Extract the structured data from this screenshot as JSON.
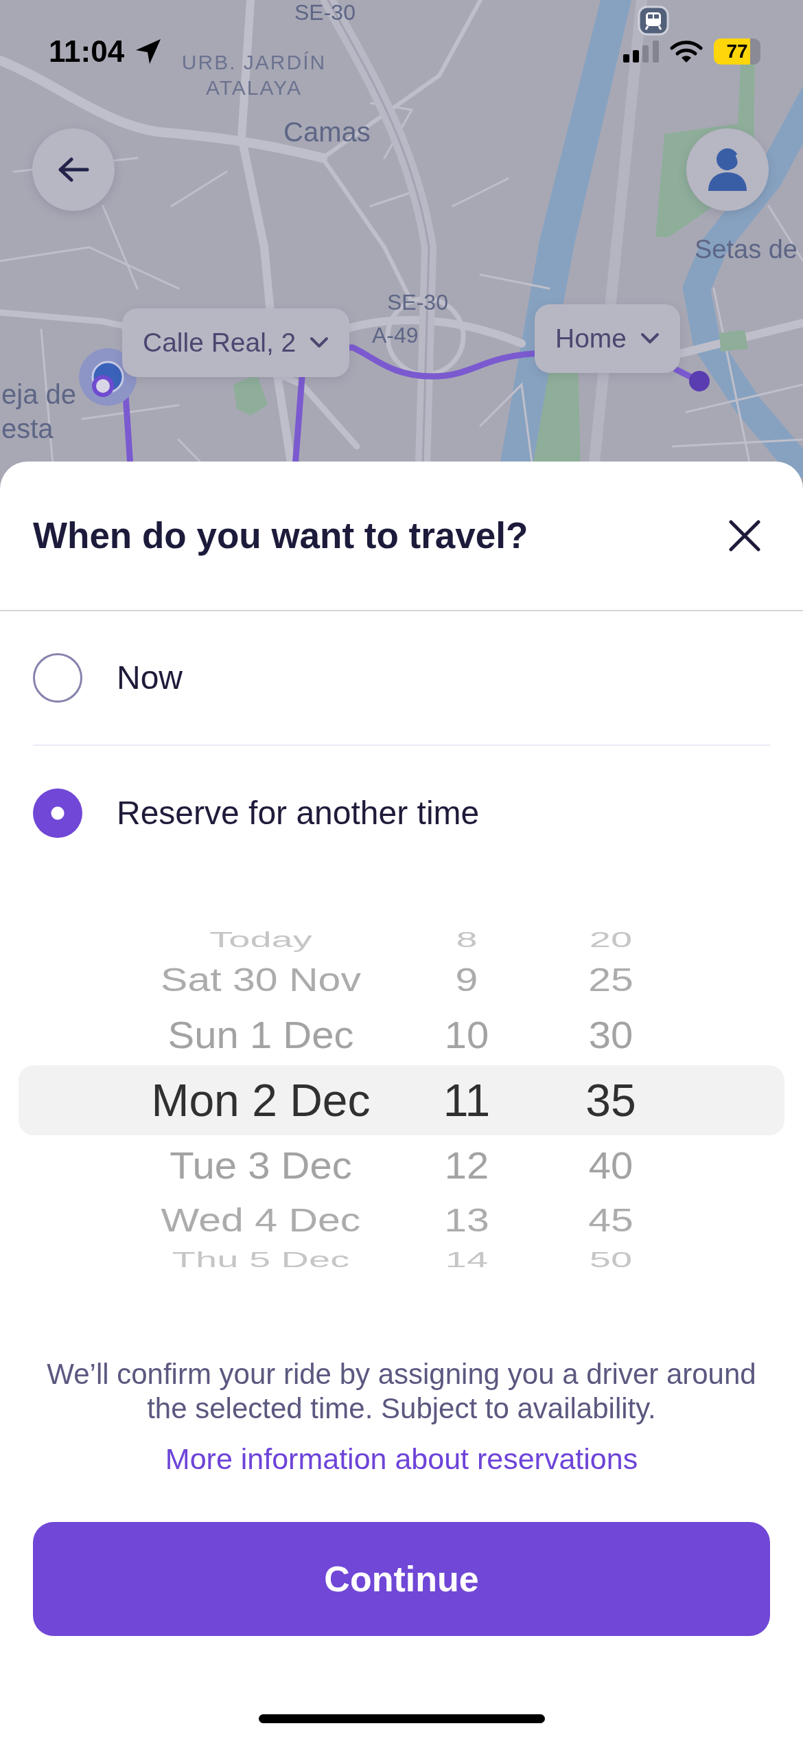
{
  "status_bar": {
    "time": "11:04",
    "battery": "77"
  },
  "map": {
    "labels": [
      "SE-30",
      "URB. JARDÍN ATALAYA",
      "Camas",
      "SE-30",
      "A-49",
      "Setas de",
      "eja de",
      "esta"
    ],
    "stops": [
      "Calle Real, 2",
      "Home"
    ]
  },
  "sheet": {
    "title": "When do you want to travel?",
    "options": [
      {
        "label": "Now",
        "selected": false
      },
      {
        "label": "Reserve for another time",
        "selected": true
      }
    ],
    "picker": {
      "columns": [
        {
          "items": [
            {
              "label": "Today",
              "selected": false
            },
            {
              "label": "Sat 30 Nov",
              "selected": false
            },
            {
              "label": "Sun 1 Dec",
              "selected": false
            },
            {
              "label": "Mon 2 Dec",
              "selected": true
            },
            {
              "label": "Tue 3 Dec",
              "selected": false
            },
            {
              "label": "Wed 4 Dec",
              "selected": false
            },
            {
              "label": "Thu 5 Dec",
              "selected": false
            }
          ]
        },
        {
          "items": [
            {
              "label": "8",
              "selected": false
            },
            {
              "label": "9",
              "selected": false
            },
            {
              "label": "10",
              "selected": false
            },
            {
              "label": "11",
              "selected": true
            },
            {
              "label": "12",
              "selected": false
            },
            {
              "label": "13",
              "selected": false
            },
            {
              "label": "14",
              "selected": false
            }
          ]
        },
        {
          "items": [
            {
              "label": "20",
              "selected": false
            },
            {
              "label": "25",
              "selected": false
            },
            {
              "label": "30",
              "selected": false
            },
            {
              "label": "35",
              "selected": true
            },
            {
              "label": "40",
              "selected": false
            },
            {
              "label": "45",
              "selected": false
            },
            {
              "label": "50",
              "selected": false
            }
          ]
        }
      ]
    },
    "note": "We’ll confirm your ride by assigning you a driver around the selected time. Subject to availability.",
    "link": "More information about reservations",
    "button": "Continue"
  }
}
